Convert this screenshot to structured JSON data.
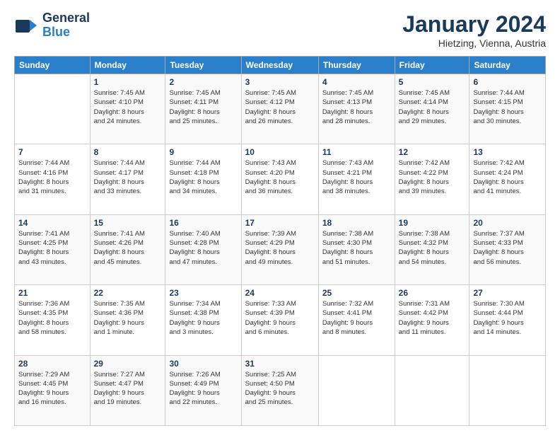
{
  "header": {
    "logo_line1": "General",
    "logo_line2": "Blue",
    "title": "January 2024",
    "subtitle": "Hietzing, Vienna, Austria"
  },
  "calendar": {
    "days_of_week": [
      "Sunday",
      "Monday",
      "Tuesday",
      "Wednesday",
      "Thursday",
      "Friday",
      "Saturday"
    ],
    "weeks": [
      [
        {
          "day": "",
          "info": ""
        },
        {
          "day": "1",
          "info": "Sunrise: 7:45 AM\nSunset: 4:10 PM\nDaylight: 8 hours\nand 24 minutes."
        },
        {
          "day": "2",
          "info": "Sunrise: 7:45 AM\nSunset: 4:11 PM\nDaylight: 8 hours\nand 25 minutes."
        },
        {
          "day": "3",
          "info": "Sunrise: 7:45 AM\nSunset: 4:12 PM\nDaylight: 8 hours\nand 26 minutes."
        },
        {
          "day": "4",
          "info": "Sunrise: 7:45 AM\nSunset: 4:13 PM\nDaylight: 8 hours\nand 28 minutes."
        },
        {
          "day": "5",
          "info": "Sunrise: 7:45 AM\nSunset: 4:14 PM\nDaylight: 8 hours\nand 29 minutes."
        },
        {
          "day": "6",
          "info": "Sunrise: 7:44 AM\nSunset: 4:15 PM\nDaylight: 8 hours\nand 30 minutes."
        }
      ],
      [
        {
          "day": "7",
          "info": "Sunrise: 7:44 AM\nSunset: 4:16 PM\nDaylight: 8 hours\nand 31 minutes."
        },
        {
          "day": "8",
          "info": "Sunrise: 7:44 AM\nSunset: 4:17 PM\nDaylight: 8 hours\nand 33 minutes."
        },
        {
          "day": "9",
          "info": "Sunrise: 7:44 AM\nSunset: 4:18 PM\nDaylight: 8 hours\nand 34 minutes."
        },
        {
          "day": "10",
          "info": "Sunrise: 7:43 AM\nSunset: 4:20 PM\nDaylight: 8 hours\nand 36 minutes."
        },
        {
          "day": "11",
          "info": "Sunrise: 7:43 AM\nSunset: 4:21 PM\nDaylight: 8 hours\nand 38 minutes."
        },
        {
          "day": "12",
          "info": "Sunrise: 7:42 AM\nSunset: 4:22 PM\nDaylight: 8 hours\nand 39 minutes."
        },
        {
          "day": "13",
          "info": "Sunrise: 7:42 AM\nSunset: 4:24 PM\nDaylight: 8 hours\nand 41 minutes."
        }
      ],
      [
        {
          "day": "14",
          "info": "Sunrise: 7:41 AM\nSunset: 4:25 PM\nDaylight: 8 hours\nand 43 minutes."
        },
        {
          "day": "15",
          "info": "Sunrise: 7:41 AM\nSunset: 4:26 PM\nDaylight: 8 hours\nand 45 minutes."
        },
        {
          "day": "16",
          "info": "Sunrise: 7:40 AM\nSunset: 4:28 PM\nDaylight: 8 hours\nand 47 minutes."
        },
        {
          "day": "17",
          "info": "Sunrise: 7:39 AM\nSunset: 4:29 PM\nDaylight: 8 hours\nand 49 minutes."
        },
        {
          "day": "18",
          "info": "Sunrise: 7:38 AM\nSunset: 4:30 PM\nDaylight: 8 hours\nand 51 minutes."
        },
        {
          "day": "19",
          "info": "Sunrise: 7:38 AM\nSunset: 4:32 PM\nDaylight: 8 hours\nand 54 minutes."
        },
        {
          "day": "20",
          "info": "Sunrise: 7:37 AM\nSunset: 4:33 PM\nDaylight: 8 hours\nand 56 minutes."
        }
      ],
      [
        {
          "day": "21",
          "info": "Sunrise: 7:36 AM\nSunset: 4:35 PM\nDaylight: 8 hours\nand 58 minutes."
        },
        {
          "day": "22",
          "info": "Sunrise: 7:35 AM\nSunset: 4:36 PM\nDaylight: 9 hours\nand 1 minute."
        },
        {
          "day": "23",
          "info": "Sunrise: 7:34 AM\nSunset: 4:38 PM\nDaylight: 9 hours\nand 3 minutes."
        },
        {
          "day": "24",
          "info": "Sunrise: 7:33 AM\nSunset: 4:39 PM\nDaylight: 9 hours\nand 6 minutes."
        },
        {
          "day": "25",
          "info": "Sunrise: 7:32 AM\nSunset: 4:41 PM\nDaylight: 9 hours\nand 8 minutes."
        },
        {
          "day": "26",
          "info": "Sunrise: 7:31 AM\nSunset: 4:42 PM\nDaylight: 9 hours\nand 11 minutes."
        },
        {
          "day": "27",
          "info": "Sunrise: 7:30 AM\nSunset: 4:44 PM\nDaylight: 9 hours\nand 14 minutes."
        }
      ],
      [
        {
          "day": "28",
          "info": "Sunrise: 7:29 AM\nSunset: 4:45 PM\nDaylight: 9 hours\nand 16 minutes."
        },
        {
          "day": "29",
          "info": "Sunrise: 7:27 AM\nSunset: 4:47 PM\nDaylight: 9 hours\nand 19 minutes."
        },
        {
          "day": "30",
          "info": "Sunrise: 7:26 AM\nSunset: 4:49 PM\nDaylight: 9 hours\nand 22 minutes."
        },
        {
          "day": "31",
          "info": "Sunrise: 7:25 AM\nSunset: 4:50 PM\nDaylight: 9 hours\nand 25 minutes."
        },
        {
          "day": "",
          "info": ""
        },
        {
          "day": "",
          "info": ""
        },
        {
          "day": "",
          "info": ""
        }
      ]
    ]
  }
}
